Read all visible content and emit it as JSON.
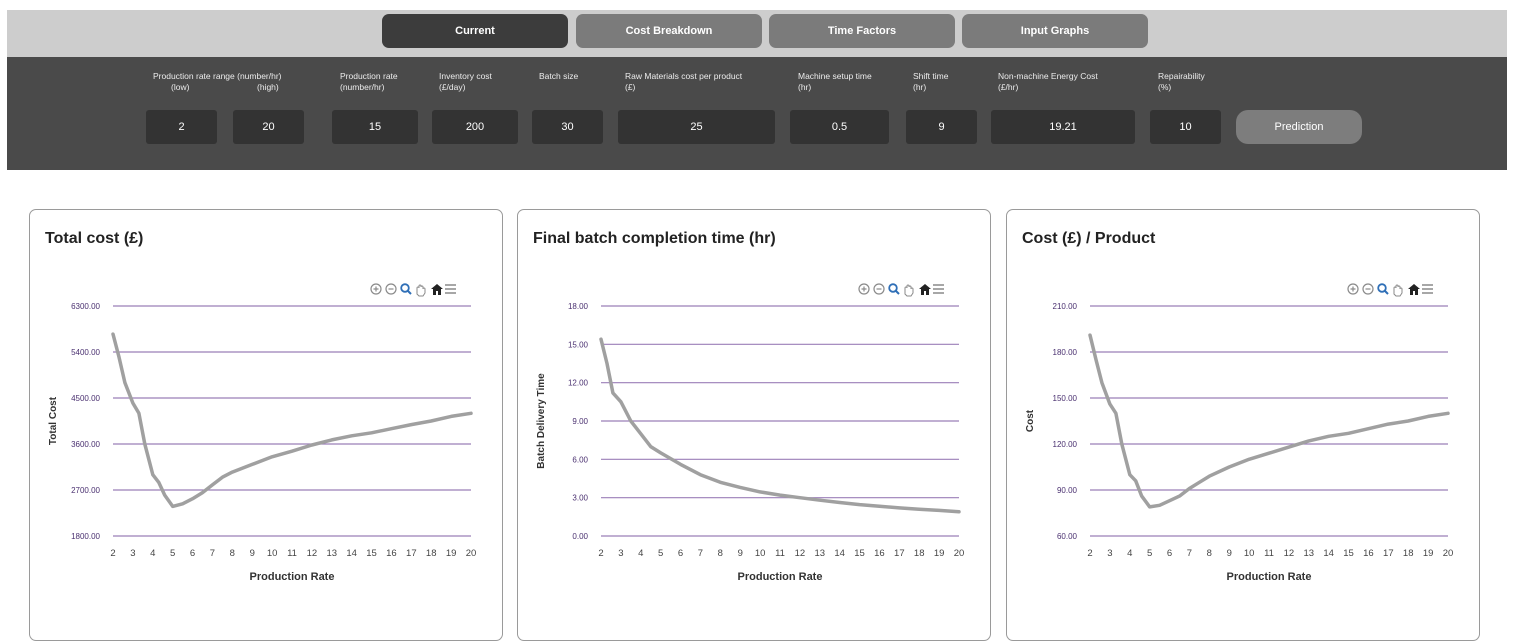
{
  "tabs": [
    {
      "label": "Current",
      "active": true
    },
    {
      "label": "Cost Breakdown",
      "active": false
    },
    {
      "label": "Time Factors",
      "active": false
    },
    {
      "label": "Input Graphs",
      "active": false
    }
  ],
  "inputs": {
    "labels": {
      "prod_range": [
        "Production rate range (number/hr)",
        "(low)",
        "(high)"
      ],
      "prod_rate": [
        "Production rate",
        "(number/hr)"
      ],
      "inventory": [
        "Inventory cost",
        "(£/day)"
      ],
      "batch": [
        "Batch size"
      ],
      "raw": [
        "Raw Materials cost per product",
        "(£)"
      ],
      "setup": [
        "Machine setup time",
        "(hr)"
      ],
      "shift": [
        "Shift time",
        "(hr)"
      ],
      "energy": [
        "Non-machine Energy Cost",
        "(£/hr)"
      ],
      "repair": [
        "Repairability",
        "(%)"
      ]
    },
    "values": {
      "prod_low": "2",
      "prod_high": "20",
      "prod_rate": "15",
      "inventory": "200",
      "batch": "30",
      "raw": "25",
      "setup": "0.5",
      "shift": "9",
      "energy": "19.21",
      "repair": "10"
    },
    "prediction_label": "Prediction"
  },
  "colors": {
    "grid": "#9b7fb8",
    "line": "#a0a0a0",
    "tick": "#4a3070",
    "axis_text": "#444444"
  },
  "chart_data": [
    {
      "type": "line",
      "title": "Total cost (£)",
      "xlabel": "Production Rate",
      "ylabel": "Total Cost",
      "yticks": [
        "1800.00",
        "2700.00",
        "3600.00",
        "4500.00",
        "5400.00",
        "6300.00"
      ],
      "ylim": [
        1800,
        6300
      ],
      "xticks": [
        2,
        3,
        4,
        5,
        6,
        7,
        8,
        9,
        10,
        11,
        12,
        13,
        14,
        15,
        16,
        17,
        18,
        19,
        20
      ],
      "x": [
        2,
        2.3,
        2.6,
        3,
        3.3,
        3.6,
        4,
        4.3,
        4.6,
        5,
        5.5,
        6,
        6.5,
        7,
        7.5,
        8,
        9,
        10,
        11,
        12,
        13,
        14,
        15,
        16,
        17,
        18,
        19,
        20
      ],
      "y": [
        5750,
        5300,
        4800,
        4400,
        4200,
        3600,
        3000,
        2850,
        2600,
        2380,
        2430,
        2530,
        2650,
        2800,
        2950,
        3050,
        3200,
        3350,
        3460,
        3580,
        3680,
        3760,
        3820,
        3900,
        3980,
        4050,
        4140,
        4200
      ]
    },
    {
      "type": "line",
      "title": "Final batch completion time (hr)",
      "xlabel": "Production Rate",
      "ylabel": "Batch Delivery Time",
      "yticks": [
        "0.00",
        "3.00",
        "6.00",
        "9.00",
        "12.00",
        "15.00",
        "18.00"
      ],
      "ylim": [
        0,
        18
      ],
      "xticks": [
        2,
        3,
        4,
        5,
        6,
        7,
        8,
        9,
        10,
        11,
        12,
        13,
        14,
        15,
        16,
        17,
        18,
        19,
        20
      ],
      "x": [
        2,
        2.3,
        2.6,
        3,
        3.5,
        4,
        4.5,
        5,
        6,
        7,
        8,
        9,
        10,
        11,
        12,
        13,
        14,
        15,
        16,
        17,
        18,
        19,
        20
      ],
      "y": [
        15.4,
        13.5,
        11.2,
        10.5,
        9.0,
        8.0,
        7.0,
        6.5,
        5.6,
        4.8,
        4.2,
        3.8,
        3.45,
        3.2,
        3.0,
        2.8,
        2.62,
        2.46,
        2.33,
        2.2,
        2.1,
        2.0,
        1.9
      ]
    },
    {
      "type": "line",
      "title": "Cost (£) / Product",
      "xlabel": "Production Rate",
      "ylabel": "Cost",
      "yticks": [
        "60.00",
        "90.00",
        "120.00",
        "150.00",
        "180.00",
        "210.00"
      ],
      "ylim": [
        60,
        210
      ],
      "xticks": [
        2,
        3,
        4,
        5,
        6,
        7,
        8,
        9,
        10,
        11,
        12,
        13,
        14,
        15,
        16,
        17,
        18,
        19,
        20
      ],
      "x": [
        2,
        2.3,
        2.6,
        3,
        3.3,
        3.6,
        4,
        4.3,
        4.6,
        5,
        5.5,
        6,
        6.5,
        7,
        7.5,
        8,
        9,
        10,
        11,
        12,
        13,
        14,
        15,
        16,
        17,
        18,
        19,
        20
      ],
      "y": [
        191,
        175,
        160,
        146,
        140,
        120,
        100,
        96,
        86,
        79,
        80,
        83,
        86,
        91,
        95,
        99,
        105,
        110,
        114,
        118,
        122,
        125,
        127,
        130,
        133,
        135,
        138,
        140
      ]
    }
  ]
}
